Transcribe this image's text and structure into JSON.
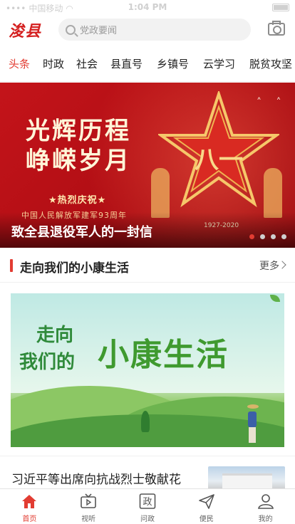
{
  "status_bar": {
    "carrier": "中国移动",
    "time": "1:04 PM"
  },
  "header": {
    "logo": "浚县",
    "search_placeholder": "党政要闻"
  },
  "tabs": [
    "头条",
    "时政",
    "社会",
    "县直号",
    "乡镇号",
    "云学习",
    "脱贫攻坚"
  ],
  "active_tab": "头条",
  "banner": {
    "title_line1": "光辉历程",
    "title_line2": "峥嵘岁月",
    "subtitle": "★热烈庆祝★",
    "subtitle2": "中国人民解放军建军93周年",
    "star_text": "八一",
    "years": "1927-2020",
    "caption": "致全县退役军人的一封信",
    "dots": 4,
    "active_dot": 0
  },
  "section": {
    "title": "走向我们的小康生活",
    "more": "更多"
  },
  "feature": {
    "line1": "走向",
    "line2": "我们的",
    "line3": "小康生活"
  },
  "news": {
    "title": "习近平等出席向抗战烈士敬献花"
  },
  "bottom_nav": [
    {
      "label": "首页",
      "icon": "home-icon",
      "active": true
    },
    {
      "label": "视听",
      "icon": "tv-icon",
      "active": false
    },
    {
      "label": "问政",
      "icon": "zheng-icon",
      "active": false
    },
    {
      "label": "便民",
      "icon": "paper-plane-icon",
      "active": false
    },
    {
      "label": "我的",
      "icon": "user-icon",
      "active": false
    }
  ],
  "colors": {
    "accent": "#e23c32",
    "banner_red": "#c4141a",
    "green": "#3f9a2f"
  }
}
